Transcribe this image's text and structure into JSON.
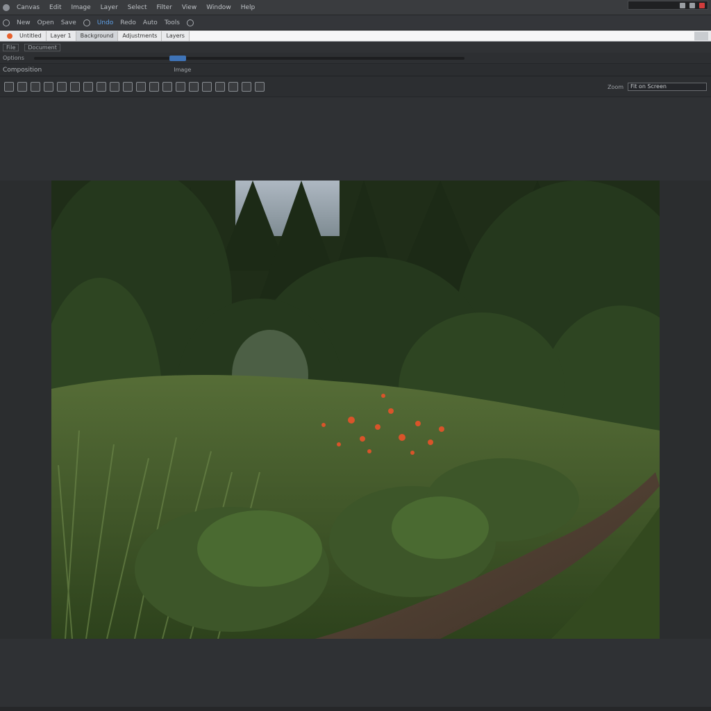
{
  "app": {
    "menu": [
      "Canvas",
      "Edit",
      "Image",
      "Layer",
      "Select",
      "Filter",
      "View",
      "Window",
      "Help"
    ]
  },
  "toolbar1": {
    "items": [
      "New",
      "Open",
      "Save",
      "Undo",
      "Redo",
      "Auto",
      "Tools"
    ]
  },
  "tabs": {
    "items": [
      "Untitled",
      "Layer 1",
      "Background",
      "Adjustments",
      "Layers"
    ]
  },
  "bar2": {
    "items": [
      "File",
      "Document"
    ]
  },
  "bar3": {
    "label": "Options"
  },
  "bar4": {
    "title": "Composition",
    "center_label": "Image"
  },
  "toolbar2": {
    "right_label": "Zoom",
    "zoom_value": "Fit on Screen"
  },
  "colors": {
    "accent": "#3f74b8",
    "tab_dot": "#e8612c",
    "close": "#d23c3c"
  }
}
